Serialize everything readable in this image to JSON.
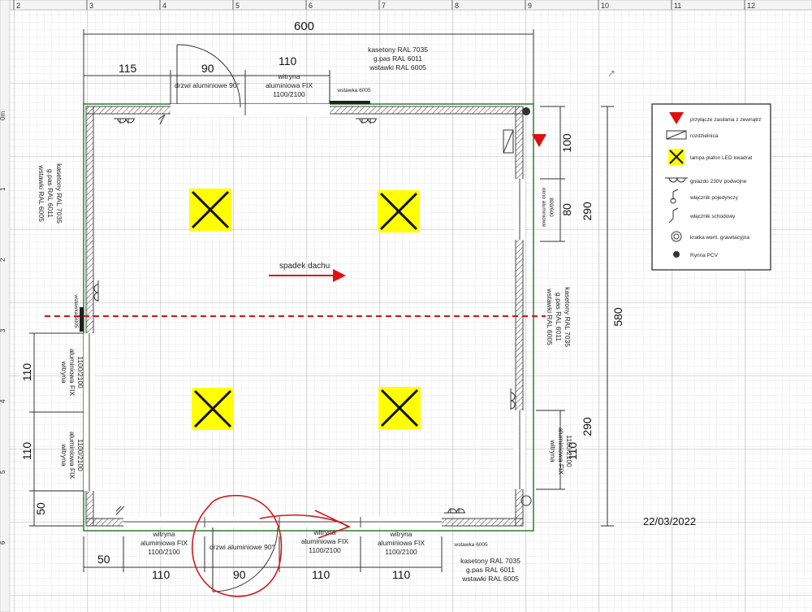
{
  "ruler": {
    "top_labels": [
      "2",
      "3",
      "4",
      "5",
      "6",
      "7",
      "8",
      "9",
      "10",
      "11",
      "12"
    ],
    "left_labels": [
      "0m",
      "1",
      "2",
      "3",
      "4",
      "5",
      "6"
    ]
  },
  "dimensions": {
    "total_width": "600",
    "top_left_115": "115",
    "door_top_90": "90",
    "window_top_110": "110",
    "right_100": "100",
    "right_80": "80",
    "right_290_top": "290",
    "right_580": "580",
    "right_290_bottom": "290",
    "right_110": "110",
    "left_110_a": "110",
    "left_110_b": "110",
    "left_50": "50",
    "bottom_50": "50",
    "bottom_110_a": "110",
    "bottom_90": "90",
    "bottom_110_b": "110",
    "bottom_110_c": "110"
  },
  "labels": {
    "top_cladding": [
      "kasetony RAL 7035",
      "g.pas RAL 6011",
      "wstawki RAL 6005"
    ],
    "top_door": "drzwi aluminiowe 90°",
    "top_window": [
      "witryna",
      "aluminiowa FIX",
      "1100/2100"
    ],
    "top_insert": "wstawka 6005",
    "left_cladding": [
      "kasetony RAL 7035",
      "g.pas RAL 6011",
      "wstawki RAL 6005"
    ],
    "left_insert": "wstawka 6005",
    "left_window_a": [
      "witryna",
      "aluminiowa FIX",
      "1100/2100"
    ],
    "left_window_b": [
      "witryna",
      "aluminiowa FIX",
      "1100/2100"
    ],
    "right_window_small": [
      "okno aluminiowe",
      "800/600"
    ],
    "right_cladding": [
      "kasetony RAL 7035",
      "g.pas RAL 6011",
      "wstawki RAL 6005"
    ],
    "right_window": [
      "witryna",
      "aluminiowa FIX",
      "1100/2100"
    ],
    "roof_slope": "spadek dachu",
    "bottom_window_a": [
      "witryna",
      "aluminiowa FIX",
      "1100/2100"
    ],
    "bottom_door": "drzwi aluminiowe 90°",
    "bottom_window_b": [
      "witryna",
      "aluminiowa FIX",
      "1100/2100"
    ],
    "bottom_window_c": [
      "witryna",
      "aluminiowa FIX",
      "1100/2100"
    ],
    "bottom_insert": "wstawka 6005",
    "bottom_cladding": [
      "kasetony RAL 7035",
      "g.pas RAL 6011",
      "wstawki RAL 6005"
    ],
    "date": "22/03/2022"
  },
  "legend": {
    "items": [
      {
        "icon": "red-triangle",
        "label": "przyłącze zasilania z zewnątrz"
      },
      {
        "icon": "distribution-board",
        "label": "rozdzielnica"
      },
      {
        "icon": "led-panel",
        "label": "lampa plafon LED kwadrat"
      },
      {
        "icon": "socket",
        "label": "gniazdo 230V podwójne"
      },
      {
        "icon": "single-switch",
        "label": "włącznik pojedynczy"
      },
      {
        "icon": "staircase-switch",
        "label": "włącznik schodowy"
      },
      {
        "icon": "gravity-vent",
        "label": "kratka went. grawitacyjna"
      },
      {
        "icon": "gutter",
        "label": "Rynna PCV"
      }
    ]
  },
  "colors": {
    "grid_fine": "#e6e6e6",
    "grid_major": "#bdbdbd",
    "wall": "#5c5c5c",
    "outline_green": "#2e7d32",
    "lamp_yellow": "#ffff00",
    "red": "#e01010"
  }
}
